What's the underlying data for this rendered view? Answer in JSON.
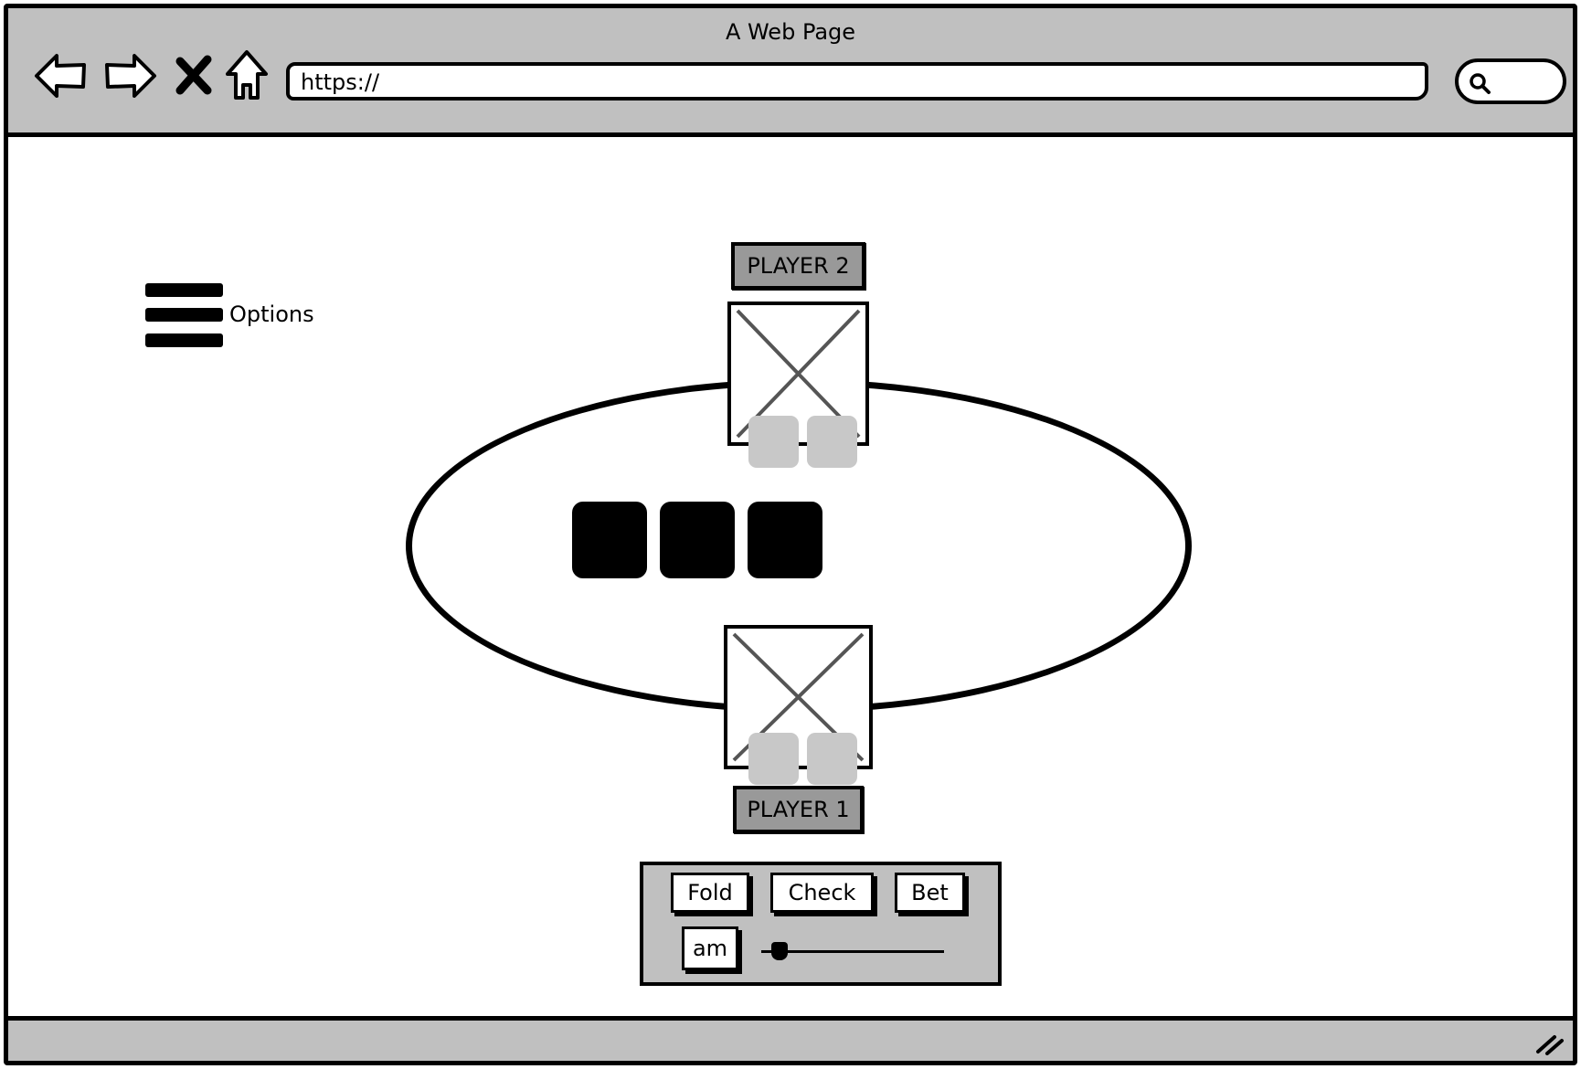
{
  "window": {
    "title": "A Web Page"
  },
  "toolbar": {
    "icons": [
      "back-arrow-icon",
      "forward-arrow-icon",
      "close-x-icon",
      "home-icon"
    ],
    "url": "https://",
    "search_icon": "search-icon"
  },
  "menu": {
    "icon": "hamburger-menu-icon",
    "label": "Options"
  },
  "table": {
    "community_cards": 3,
    "players": [
      {
        "label": "PLAYER 2",
        "hole_cards": 2
      },
      {
        "label": "PLAYER 1",
        "hole_cards": 2
      }
    ]
  },
  "actions": {
    "fold": "Fold",
    "check": "Check",
    "bet": "Bet",
    "amount": "am",
    "slider_level": 0.1
  },
  "colors": {
    "chrome": "#c0c0c0",
    "player_label": "#999999",
    "hole_card": "#c8c8c8",
    "community_card": "#000000"
  }
}
